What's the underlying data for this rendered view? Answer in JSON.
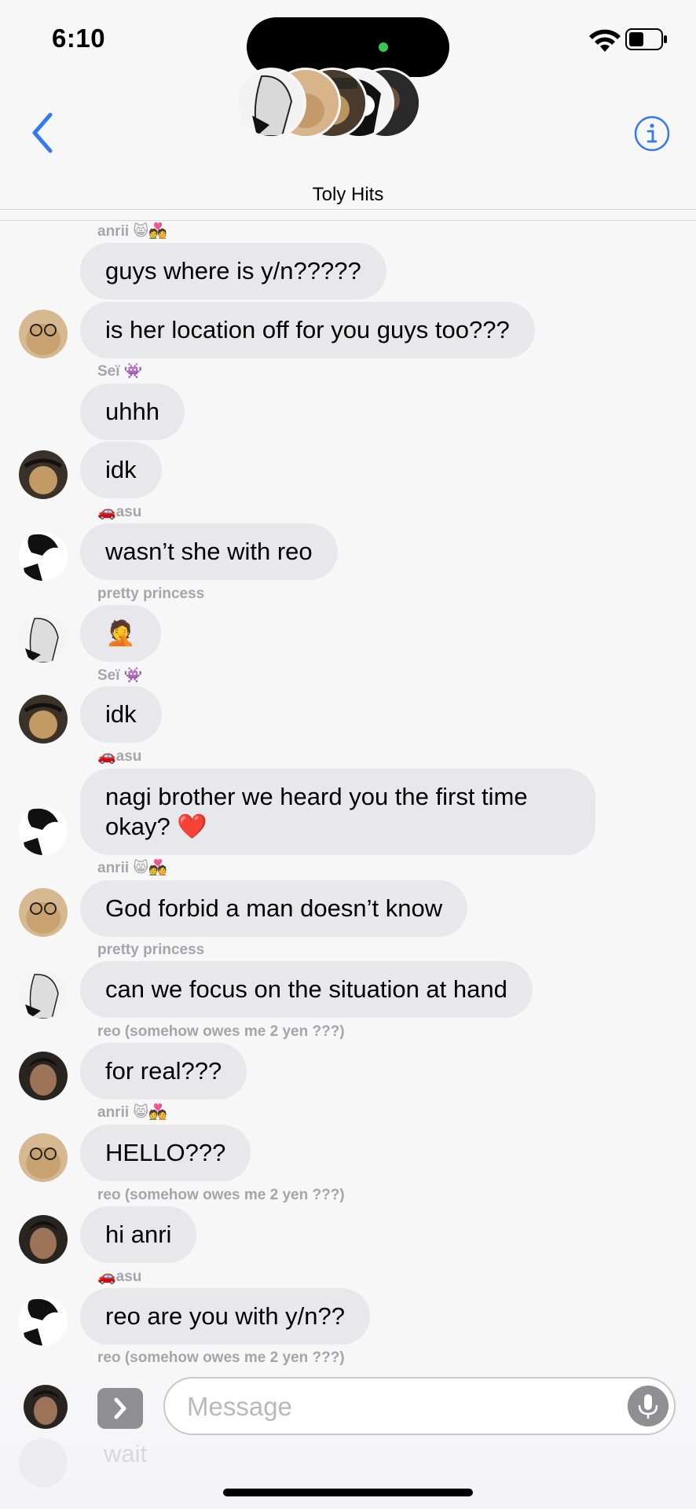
{
  "status_bar": {
    "time": "6:10"
  },
  "header": {
    "group_name": "Toly Hits",
    "back_icon": "chevron-left-icon",
    "info_icon": "info-circle-icon",
    "accent_color": "#3478f6"
  },
  "messages": [
    {
      "sender": "anrii 😸💑",
      "text": "guys where is y/n?????"
    },
    {
      "text": "is her location off for you guys too???"
    },
    {
      "sender": "Seï 👾",
      "text": "uhhh"
    },
    {
      "text": "idk"
    },
    {
      "sender": "🚗asu",
      "text": "wasn’t she with reo"
    },
    {
      "sender": "pretty princess",
      "text": "🤦"
    },
    {
      "sender": "Seï 👾",
      "text": "idk"
    },
    {
      "sender": "🚗asu",
      "text": "nagi brother we heard you the first time okay? ❤️"
    },
    {
      "sender": "anrii 😸💑",
      "text": "God forbid a man doesn’t know"
    },
    {
      "sender": "pretty princess",
      "text": "can we focus on the situation at hand"
    },
    {
      "sender": "reo (somehow owes me 2 yen ???)",
      "text": "for real???"
    },
    {
      "sender": "anrii 😸💑",
      "text": "HELLO???"
    },
    {
      "sender": "reo (somehow owes me 2 yen ???)",
      "text": "hi anri"
    },
    {
      "sender": "🚗asu",
      "text": "reo are you with y/n??"
    },
    {
      "sender": "reo (somehow owes me 2 yen ???)",
      "text": "wait"
    }
  ],
  "composer": {
    "placeholder": "Message",
    "apps_icon": "chevron-right-icon",
    "mic_icon": "microphone-icon"
  },
  "colors": {
    "bubble": "#e8e8ec",
    "background": "#f7f7f8",
    "sender_label": "#a5a5aa"
  }
}
